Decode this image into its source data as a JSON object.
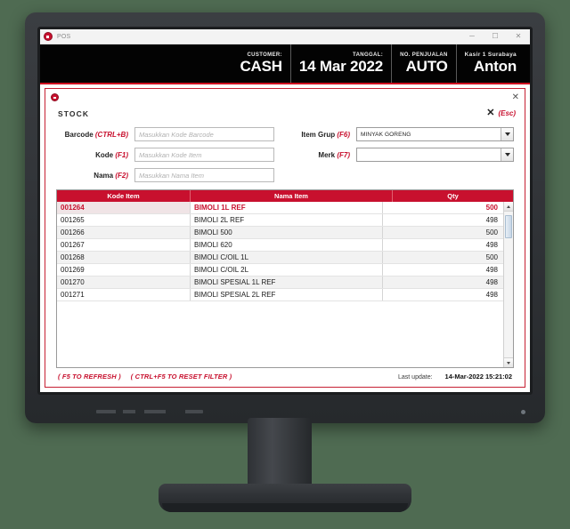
{
  "window": {
    "title": "POS",
    "app_icon": "pos-logo-icon",
    "controls": {
      "minimize": "─",
      "maximize": "☐",
      "close": "✕"
    }
  },
  "pos_header": {
    "cells": [
      {
        "label": "CUSTOMER:",
        "value": "CASH",
        "name": "customer"
      },
      {
        "label": "TANGGAL:",
        "value": "14 Mar 2022",
        "name": "tanggal"
      },
      {
        "label": "NO. PENJUALAN",
        "value": "AUTO",
        "name": "no-penjualan"
      },
      {
        "label": "Kasir 1 Surabaya",
        "value": "Anton",
        "name": "kasir"
      }
    ],
    "accent_color": "#cf1020",
    "background_color": "#030303"
  },
  "modal": {
    "logo": "pos-logo-icon",
    "close_x": "✕",
    "title": "STOCK",
    "esc_x": "✕",
    "esc_label": "(Esc)",
    "border_color": "#c62033",
    "form": {
      "left": [
        {
          "name": "barcode",
          "label": "Barcode",
          "fkey": "(CTRL+B)",
          "value": "",
          "placeholder": "Masukkan Kode Barcode"
        },
        {
          "name": "kode",
          "label": "Kode",
          "fkey": "(F1)",
          "value": "",
          "placeholder": "Masukkan Kode Item"
        },
        {
          "name": "nama",
          "label": "Nama",
          "fkey": "(F2)",
          "value": "",
          "placeholder": "Masukkan Nama Item"
        }
      ],
      "right": [
        {
          "name": "item-grup",
          "label": "Item Grup",
          "fkey": "(F6)",
          "value": "MINYAK GORENG"
        },
        {
          "name": "merk",
          "label": "Merk",
          "fkey": "(F7)",
          "value": ""
        }
      ]
    },
    "table": {
      "header_color": "#c8102e",
      "columns": [
        "Kode Item",
        "Nama Item",
        "Qty"
      ],
      "rows": [
        {
          "kode": "001264",
          "nama": "BIMOLI 1L REF",
          "qty": "500",
          "selected": true
        },
        {
          "kode": "001265",
          "nama": "BIMOLI 2L REF",
          "qty": "498",
          "selected": false
        },
        {
          "kode": "001266",
          "nama": "BIMOLI 500",
          "qty": "500",
          "selected": false
        },
        {
          "kode": "001267",
          "nama": "BIMOLI 620",
          "qty": "498",
          "selected": false
        },
        {
          "kode": "001268",
          "nama": "BIMOLI C/OIL 1L",
          "qty": "500",
          "selected": false
        },
        {
          "kode": "001269",
          "nama": "BIMOLI C/OIL 2L",
          "qty": "498",
          "selected": false
        },
        {
          "kode": "001270",
          "nama": "BIMOLI SPESIAL 1L REF",
          "qty": "498",
          "selected": false
        },
        {
          "kode": "001271",
          "nama": "BIMOLI SPESIAL 2L REF",
          "qty": "498",
          "selected": false
        }
      ]
    },
    "footer": {
      "hint_refresh": "( F5 TO REFRESH )",
      "hint_reset": "( CTRL+F5 TO RESET FILTER )",
      "last_update_label": "Last update:",
      "last_update_value": "14-Mar-2022 15:21:02"
    }
  }
}
